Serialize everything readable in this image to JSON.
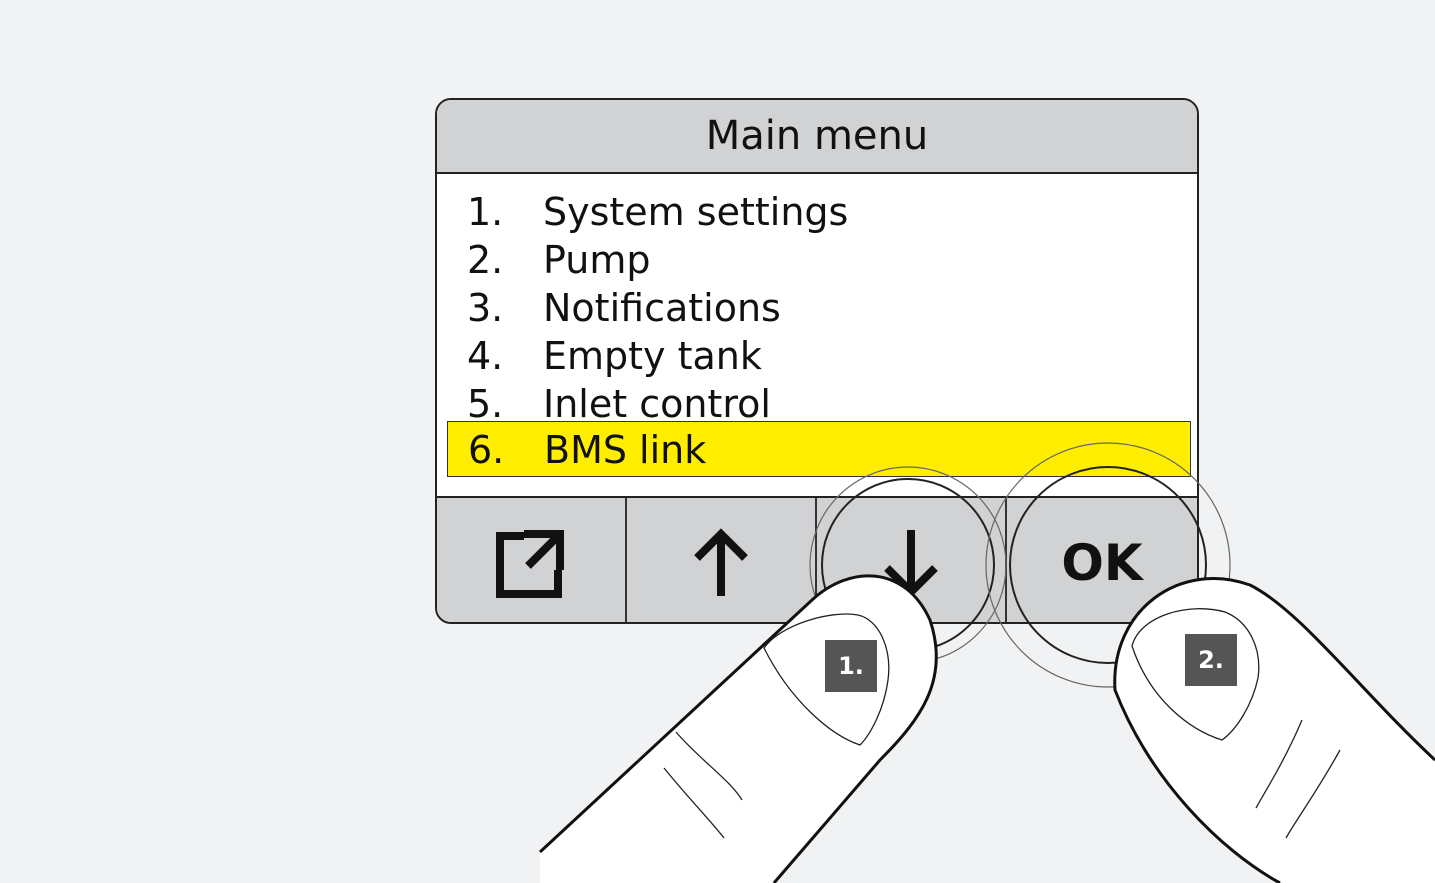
{
  "header": {
    "title": "Main menu"
  },
  "menu": {
    "items": [
      {
        "num": "1.",
        "label": "System settings"
      },
      {
        "num": "2.",
        "label": "Pump"
      },
      {
        "num": "3.",
        "label": "Notifications"
      },
      {
        "num": "4.",
        "label": "Empty tank"
      },
      {
        "num": "5.",
        "label": "Inlet control"
      },
      {
        "num": "6.",
        "label": "BMS link",
        "selected": true
      }
    ]
  },
  "buttons": {
    "exit_icon": "external-link-icon",
    "up_icon": "arrow-up-icon",
    "down_icon": "arrow-down-icon",
    "ok_label": "OK"
  },
  "steps": {
    "step1": "1.",
    "step2": "2."
  },
  "colors": {
    "highlight": "#ffee00",
    "panel": "#d1d2d4",
    "badge": "#555555"
  }
}
